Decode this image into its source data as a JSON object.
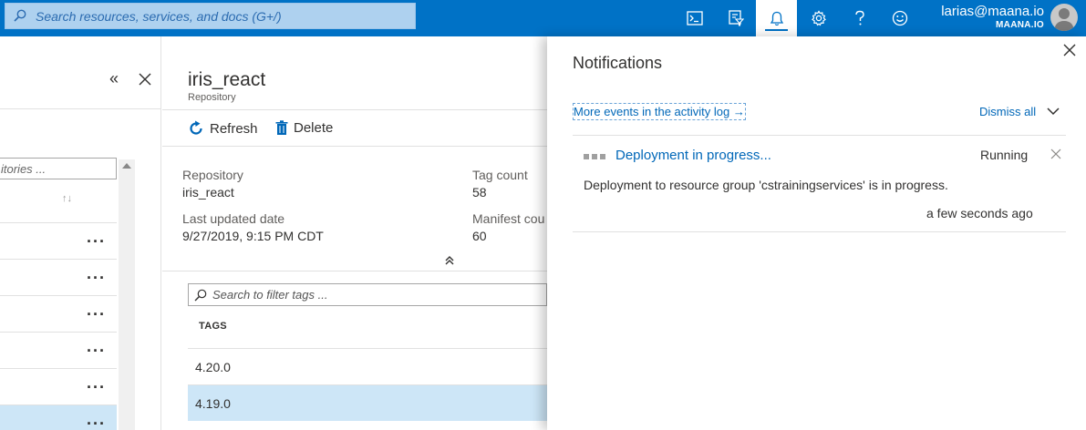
{
  "topbar": {
    "search_placeholder": "Search resources, services, and docs (G+/)",
    "icons": [
      "cloud-shell-icon",
      "directory-filter-icon",
      "notifications-bell-icon",
      "settings-gear-icon",
      "help-icon",
      "feedback-smiley-icon"
    ],
    "user_email": "larias@maana.io",
    "user_org": "MAANA.IO",
    "brand_color": "#0072c6"
  },
  "left_blade": {
    "filter_placeholder": "itories ...",
    "row_count": 7
  },
  "main": {
    "title": "iris_react",
    "subtitle": "Repository",
    "commands": {
      "refresh": "Refresh",
      "delete": "Delete"
    },
    "essentials": {
      "repository_label": "Repository",
      "repository_value": "iris_react",
      "updated_label": "Last updated date",
      "updated_value": "9/27/2019, 9:15 PM CDT",
      "tagcount_label": "Tag count",
      "tagcount_value": "58",
      "manifest_label": "Manifest cou",
      "manifest_value": "60"
    },
    "tag_filter_placeholder": "Search to filter tags ...",
    "tags_header": "TAGS",
    "tags": [
      "4.20.0",
      "4.19.0"
    ]
  },
  "notifications": {
    "title": "Notifications",
    "activity_link": "More events in the activity log →",
    "dismiss_all": "Dismiss all",
    "item": {
      "title": "Deployment in progress...",
      "status": "Running",
      "description": "Deployment to resource group 'cstrainingservices' is in progress.",
      "time": "a few seconds ago"
    }
  }
}
